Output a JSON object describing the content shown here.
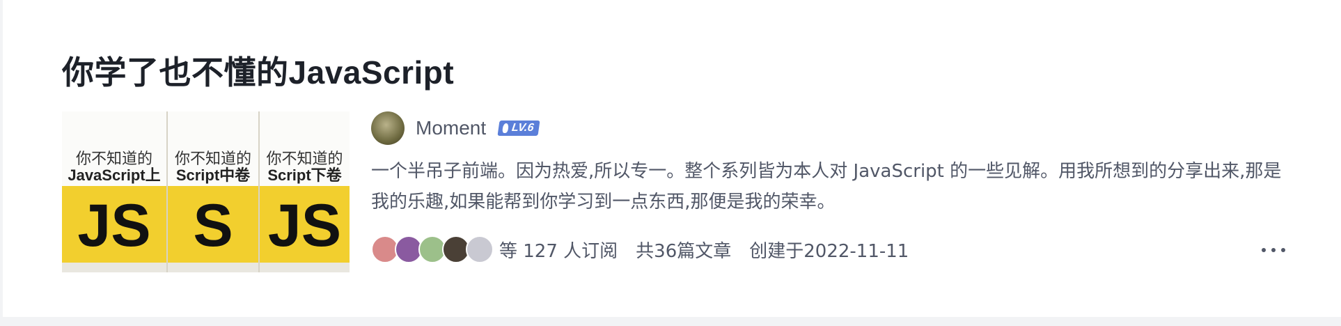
{
  "column": {
    "title": "你学了也不懂的JavaScript",
    "description": "一个半吊子前端。因为热爱,所以专一。整个系列皆为本人对 JavaScript 的一些见解。用我所想到的分享出来,那是我的乐趣,如果能帮到你学习到一点东西,那便是我的荣幸。"
  },
  "cover": {
    "books": [
      {
        "cn": "你不知道的",
        "word": "JavaScript上卷",
        "big": "JS"
      },
      {
        "cn": "你不知道的",
        "word": "Script中卷",
        "big": "S"
      },
      {
        "cn": "你不知道的",
        "word": "Script下卷",
        "big": "JS"
      }
    ]
  },
  "author": {
    "name": "Moment",
    "level": "LV.6"
  },
  "meta": {
    "subscribers_text": "等 127 人订阅",
    "articles_text": "共36篇文章",
    "created_text": "创建于2022-11-11"
  },
  "subscriber_avatars": [
    {
      "color": "#d98a8a"
    },
    {
      "color": "#8a5aa0"
    },
    {
      "color": "#9cc08a"
    },
    {
      "color": "#4a4036"
    },
    {
      "color": "#c9c9d2"
    }
  ],
  "colors": {
    "title": "#1d2129",
    "secondary_text": "#515767",
    "level_badge": "#5b7fd9",
    "background": "#f2f3f5"
  }
}
